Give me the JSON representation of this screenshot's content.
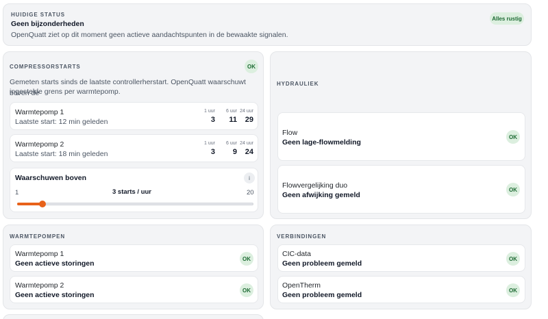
{
  "status": {
    "section": "HUIDIGE STATUS",
    "headline": "Geen bijzonderheden",
    "description": "OpenQuatt ziet op dit moment geen actieve aandachtspunten in de bewaakte signalen.",
    "badge": "Alles rustig"
  },
  "compressor": {
    "section": "COMPRESSORSTARTS",
    "badge": "OK",
    "description_line1": "Gemeten starts sinds de laatste controllerherstart. OpenQuatt waarschuwt boven de",
    "description_line2": "ingestelde grens per warmtepomp.",
    "pumps": [
      {
        "name": "Warmtepomp 1",
        "last_start": "Laatste start: 12 min geleden",
        "stats": [
          {
            "label": "1 uur",
            "value": "3"
          },
          {
            "label": "6 uur",
            "value": "11"
          },
          {
            "label": "24 uur",
            "value": "29"
          }
        ]
      },
      {
        "name": "Warmtepomp 2",
        "last_start": "Laatste start: 18 min geleden",
        "stats": [
          {
            "label": "1 uur",
            "value": "3"
          },
          {
            "label": "6 uur",
            "value": "9"
          },
          {
            "label": "24 uur",
            "value": "24"
          }
        ]
      }
    ],
    "threshold": {
      "title": "Waarschuwen boven",
      "info": "i",
      "min": "1",
      "max": "20",
      "value_label": "3 starts / uur",
      "value": 3,
      "range": [
        1,
        20
      ]
    }
  },
  "hydraulics": {
    "section": "HYDRAULIEK",
    "items": [
      {
        "title": "Flow",
        "status": "Geen lage-flowmelding",
        "badge": "OK"
      },
      {
        "title": "Flowvergelijking duo",
        "status": "Geen afwijking gemeld",
        "badge": "OK"
      }
    ]
  },
  "heatpumps": {
    "section": "WARMTEPOMPEN",
    "items": [
      {
        "title": "Warmtepomp 1",
        "status": "Geen actieve storingen",
        "badge": "OK"
      },
      {
        "title": "Warmtepomp 2",
        "status": "Geen actieve storingen",
        "badge": "OK"
      }
    ]
  },
  "connections": {
    "section": "VERBINDINGEN",
    "items": [
      {
        "title": "CIC-data",
        "status": "Geen probleem gemeld",
        "badge": "OK"
      },
      {
        "title": "OpenTherm",
        "status": "Geen probleem gemeld",
        "badge": "OK"
      }
    ]
  },
  "colors": {
    "accent": "#e8621a",
    "ok_bg": "#dcefdf",
    "ok_text": "#1e6b34",
    "card_bg": "#f3f4f6"
  }
}
